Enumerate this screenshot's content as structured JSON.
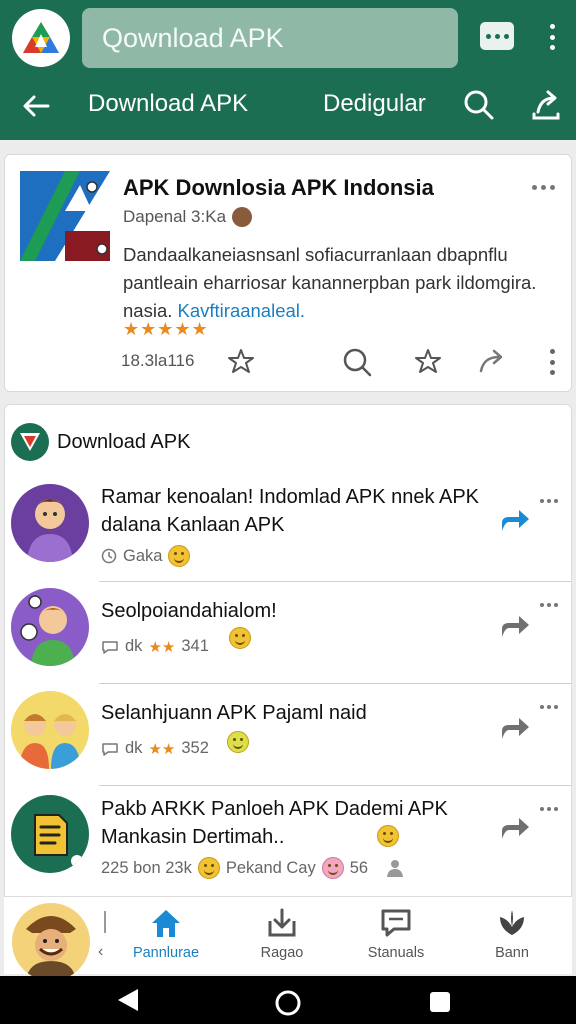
{
  "header": {
    "search_placeholder": "Qownload APK",
    "nav_title": "Download APK",
    "nav_secondary": "Dedigular"
  },
  "app_card": {
    "title": "APK Downlosia APK Indonsia",
    "developer": "Dapenal 3:Ka",
    "description": "Dandaalkaneiasnsanl sofiacurranlaan dbapnflu pantleain eharriosar kanannerpban park ildomgira. nasia.",
    "description_link": "Kavftiraanaleal.",
    "rating_stars": "★★★★★",
    "count": "18.3la116"
  },
  "feed": {
    "title": "Download APK",
    "posts": [
      {
        "text": "Ramar kenoalan! Indomlad APK nnek APK dalana Kanlaan APK",
        "meta": "Gaka"
      },
      {
        "text": "Seolpoiandahialom!",
        "meta_prefix": "dk",
        "meta_stars": "★★",
        "meta_count": "341"
      },
      {
        "text": "Selanhjuann APK Pajaml naid",
        "meta_prefix": "dk",
        "meta_stars": "★★",
        "meta_count": "352"
      },
      {
        "text": "Pakb ARKK Panloeh APK Dademi APK Mankasin Dertimah..",
        "meta_a": "225 bon 23k",
        "meta_b": "Pekand Cay",
        "meta_c": "56"
      }
    ]
  },
  "bottom_nav": {
    "tabs": [
      {
        "label": "Pannlurae",
        "active": true
      },
      {
        "label": "Ragao",
        "active": false
      },
      {
        "label": "Stanuals",
        "active": false
      },
      {
        "label": "Bann",
        "active": false
      }
    ]
  },
  "colors": {
    "header": "#1c6e53",
    "accent": "#1a7fc0",
    "star": "#e98a1a"
  }
}
